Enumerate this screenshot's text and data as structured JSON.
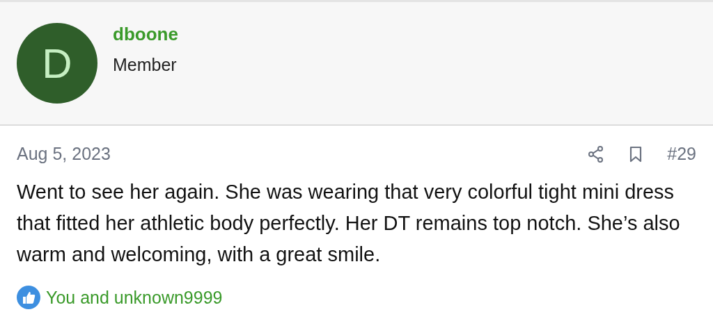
{
  "post": {
    "author": {
      "initial": "D",
      "name": "dboone",
      "role": "Member"
    },
    "date": "Aug 5, 2023",
    "number": "#29",
    "body": "Went to see her again. She was wearing that very colorful tight mini dress that fitted her athletic body perfectly. Her DT remains top notch. She’s also warm and welcoming, with a great smile.",
    "reactions": "You and unknown9999"
  }
}
